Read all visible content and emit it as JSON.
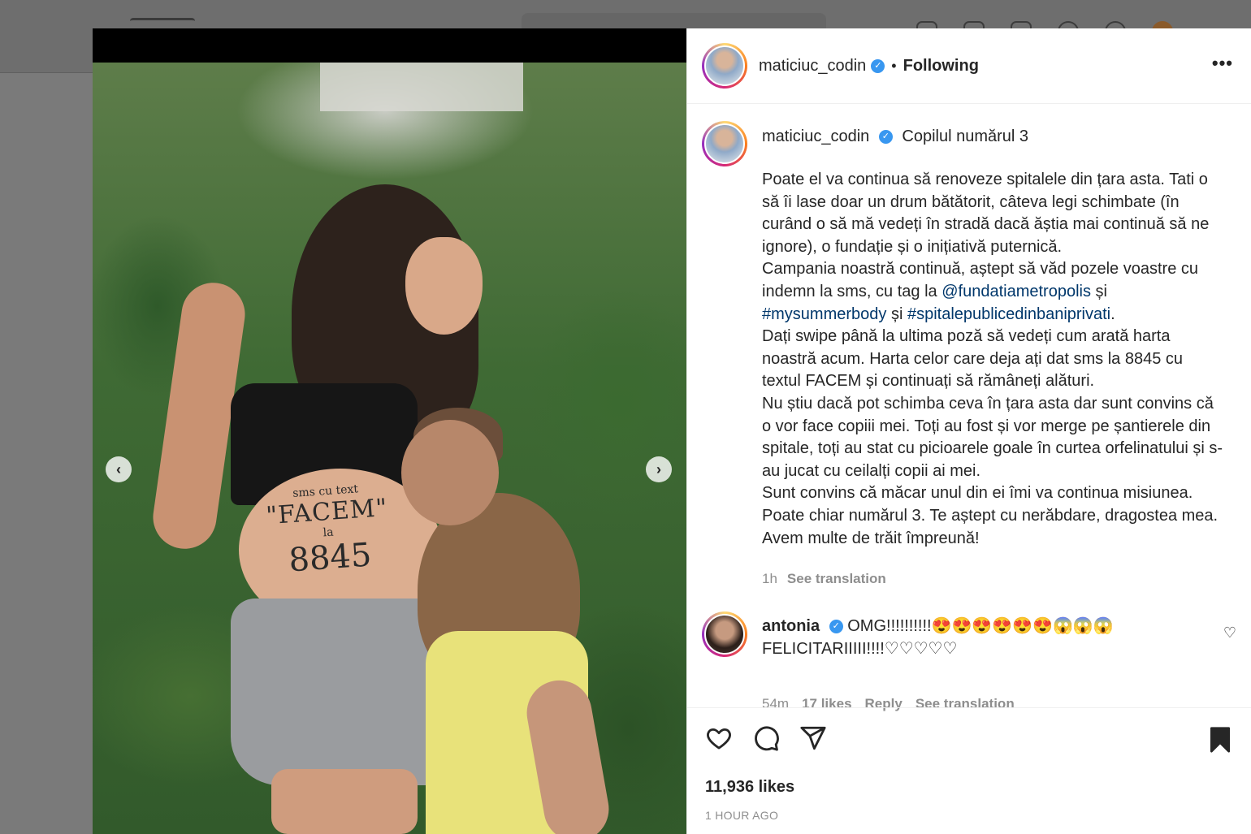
{
  "post": {
    "username": "maticiuc_codin",
    "follow_status": "Following",
    "separator": "•",
    "more_label": "•••",
    "caption_title": "Copilul numărul 3",
    "caption_lines": [
      "Poate el va continua să renoveze spitalele din țara asta. Tati o să îi lase doar un drum bătătorit, câteva legi schimbate (în curând o să mă vedeți în stradă dacă ăștia mai continuă să ne ignore), o fundație și o inițiativă puternică.",
      "Campania noastră continuă, aștept să văd pozele voastre cu indemn la sms, cu tag la ",
      "@fundatiametropolis",
      " și ",
      "#mysummerbody",
      " și ",
      "#spitalepublicedinbaniprivati",
      ".",
      "Dați swipe până la ultima poză să vedeți cum arată harta noastră acum. Harta celor care deja ați dat sms la 8845 cu textul FACEM și continuați să rămâneți alături.",
      "Nu știu dacă pot schimba ceva în țara asta dar sunt convins că o vor face copiii mei. Toți au fost și vor merge pe șantierele din spitale, toți au stat cu picioarele goale în curtea orfelinatului și s-au jucat cu ceilalți copii ai mei.",
      "Sunt convins că măcar unul din ei îmi va continua misiunea.",
      "Poate chiar numărul 3. Te aștept cu nerăbdare, dragostea mea.",
      "Avem multe de trăit împreună!"
    ],
    "caption_time": "1h",
    "see_translation": "See translation",
    "likes": "11,936 likes",
    "posted": "1 HOUR AGO"
  },
  "photo": {
    "belly_small": "sms cu text",
    "belly_big": "\"FACEM\"",
    "belly_la": "la",
    "belly_number": "8845"
  },
  "comment": {
    "username": "antonia",
    "text": "OMG!!!!!!!!!!😍😍😍😍😍😍😱😱😱 FELICITARIIIII!!!!♡♡♡♡♡",
    "time": "54m",
    "likes": "17 likes",
    "reply": "Reply",
    "see_translation": "See translation"
  },
  "icons": {
    "verified": "✓",
    "prev": "‹",
    "next": "›",
    "heart_small": "♡"
  },
  "colors": {
    "link": "#00376b",
    "verified": "#3897f0",
    "overlay": "#7a7a7a"
  }
}
